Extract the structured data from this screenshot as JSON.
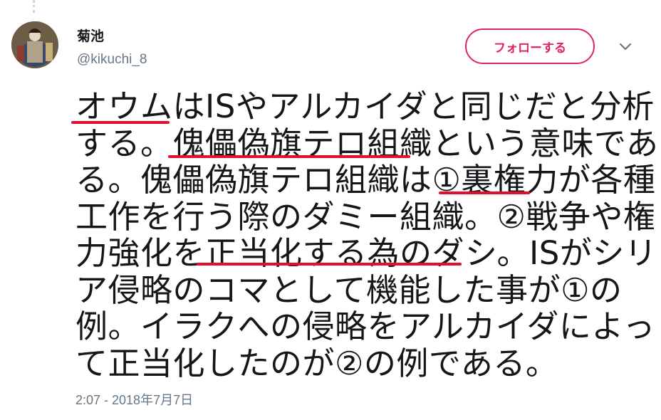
{
  "user": {
    "display_name": "菊池",
    "screen_name": "@kikuchi_8"
  },
  "follow_button": {
    "label": "フォローする"
  },
  "menu_icon": "chevron-down-icon",
  "tweet": {
    "lines": [
      "オウムはISやアルカイダと同じだと分析",
      "する。傀儡偽旗テロ組織という意味であ",
      "る。傀儡偽旗テロ組織は①裏権力が各種",
      "工作を行う際のダミー組織。②戦争や権",
      "力強化を正当化する為のダシ。ISがシリ",
      "ア侵略のコマとして機能した事が①の",
      "例。イラクへの侵略をアルカイダによっ",
      "て正当化したのが②の例である。"
    ],
    "annotations": [
      "red-underline",
      "red-underline",
      "red-underline",
      "red-underline"
    ]
  },
  "timestamp": "2:07 - 2018年7月7日",
  "colors": {
    "accent": "#e0245e",
    "underline": "#e0102e",
    "text": "#14171a",
    "muted": "#657786"
  }
}
